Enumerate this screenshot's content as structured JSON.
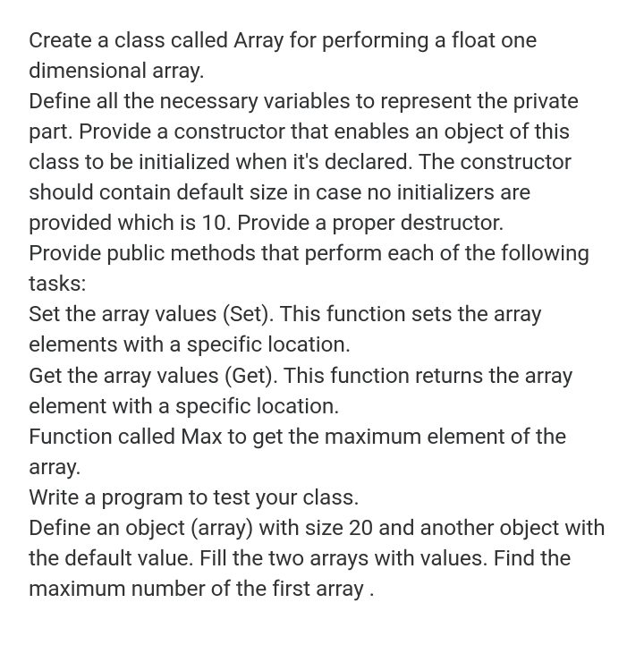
{
  "paragraphs": {
    "p1": "Create a class called Array for performing a float one dimensional array.",
    "p2": "Define all the necessary variables to represent the private part. Provide a constructor that enables an object of this class to be initialized when it's declared. The constructor should contain default size in case no initializers are provided which is 10. Provide a proper destructor.",
    "p3": "Provide public methods that perform each of the following tasks:",
    "p4": "Set the array values (Set). This function sets the array elements with a specific location.",
    "p5": "Get the array values (Get). This function returns the array element with a specific location.",
    "p6": "Function called Max to get the maximum element of the array.",
    "p7": "Write a program to test your class.",
    "p8": "Define an object (array) with size 20 and another object with the default value. Fill the two arrays with values. Find the maximum number of the first array ."
  }
}
